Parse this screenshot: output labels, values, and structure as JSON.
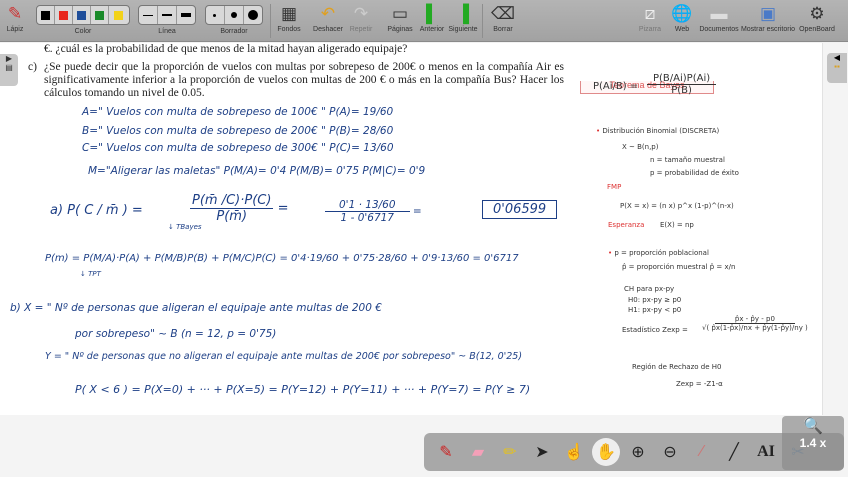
{
  "toolbar": {
    "pen": "Lápiz",
    "color": "Color",
    "line": "Línea",
    "eraser": "Borrador",
    "backgrounds": "Fondos",
    "undo": "Deshacer",
    "redo": "Repetir",
    "pages": "Páginas",
    "previous": "Anterior",
    "next": "Siguiente",
    "clear": "Borrar",
    "board": "Pizarra",
    "web": "Web",
    "documents": "Documentos",
    "show_desktop": "Mostrar escritorio",
    "app": "OpenBoard",
    "colors": [
      "#000000",
      "#e8261c",
      "#1f4e9a",
      "#1a8a2a",
      "#f2d21a"
    ]
  },
  "printed": {
    "line0": "€. ¿cuál es la probabilidad de que menos de la mitad hayan aligerado equipaje?",
    "c_label": "c)",
    "c_text": "¿Se puede decir que la proporción de vuelos con multas por sobrepeso de 200€ o menos en la compañía Air es significativamente inferior a la proporción de vuelos con multas de 200 € o más en la compañía Bus? Hacer los cálculos tomando un nivel de 0.05."
  },
  "bayes_box": "Teorema de Bayes",
  "hand": {
    "A": "A=\" Vuelos con multa de sobrepeso de 100€ \"  P(A)= 19/60",
    "B": "B=\" Vuelos con multa de sobrepeso de 200€ \"  P(B)= 28/60",
    "C": "C=\" Vuelos con multa de sobrepeso de 300€ \"  P(C)= 13/60",
    "M": "M=\"Aligerar las maletas\"  P(M/A)= 0'4    P(M/B)= 0'75    P(M|C)= 0'9",
    "a_lhs": "a)  P( C / m̄ ) =",
    "a_num": "P(m̄ /C)·P(C)",
    "a_den": "P(m̄)",
    "a_num2": "0'1 · 13/60",
    "a_den2": "1 - 0'6717",
    "a_result": "0'06599",
    "bayes_note": "↓ TBayes",
    "pm": "P(m) = P(M/A)·P(A) + P(M/B)P(B) + P(M/C)P(C) = 0'4·19/60 + 0'75·28/60 + 0'9·13/60 = 0'6717",
    "tpt": "↓ TPT",
    "b1": "b)   X = \" Nº de personas que aligeran el equipaje ante multas de 200 €",
    "b2": "por sobrepeso\" ~ B (n = 12, p = 0'75)",
    "y1": "Y = \" Nº de personas que no aligeran el equipaje ante multas de 200€ por sobrepeso\" ~ B(12, 0'25)",
    "p1": "P( X < 6 ) = P(X=0) + ··· + P(X=5) = P(Y=12) + P(Y=11) + ··· + P(Y=7) = P(Y ≥ 7)"
  },
  "notes": {
    "bayes_lhs": "P(Ai/B) =",
    "bayes_num": "P(B/Ai)P(Ai)",
    "bayes_den": "P(B)",
    "binom": "Distribución Binomial (DISCRETA)",
    "xb": "X ~ B(n,p)",
    "n": "n = tamaño muestral",
    "p": "p = probabilidad de éxito",
    "fmp": "FMP",
    "fmp_formula": "P(X = x) = (n x) p^x (1-p)^(n-x)",
    "esp": "Esperanza",
    "esp_formula": "E(X) = np",
    "pop": "p = proporción poblacional",
    "mues": "p̂ = proporción muestral   p̂ = x/n",
    "ch": "CH para px-py",
    "h0": "H0: px-py ≥ p0",
    "h1": "H1: px-py < p0",
    "stat": "Estadístico  Zexp =",
    "stat_num": "p̂x - p̂y - p0",
    "stat_den": "√( p̂x(1-p̂x)/nx + p̂y(1-p̂y)/ny )",
    "region": "Región de Rechazo de H0",
    "region_f": "Zexp = -Z1-α"
  },
  "zoom": "1.4 x"
}
